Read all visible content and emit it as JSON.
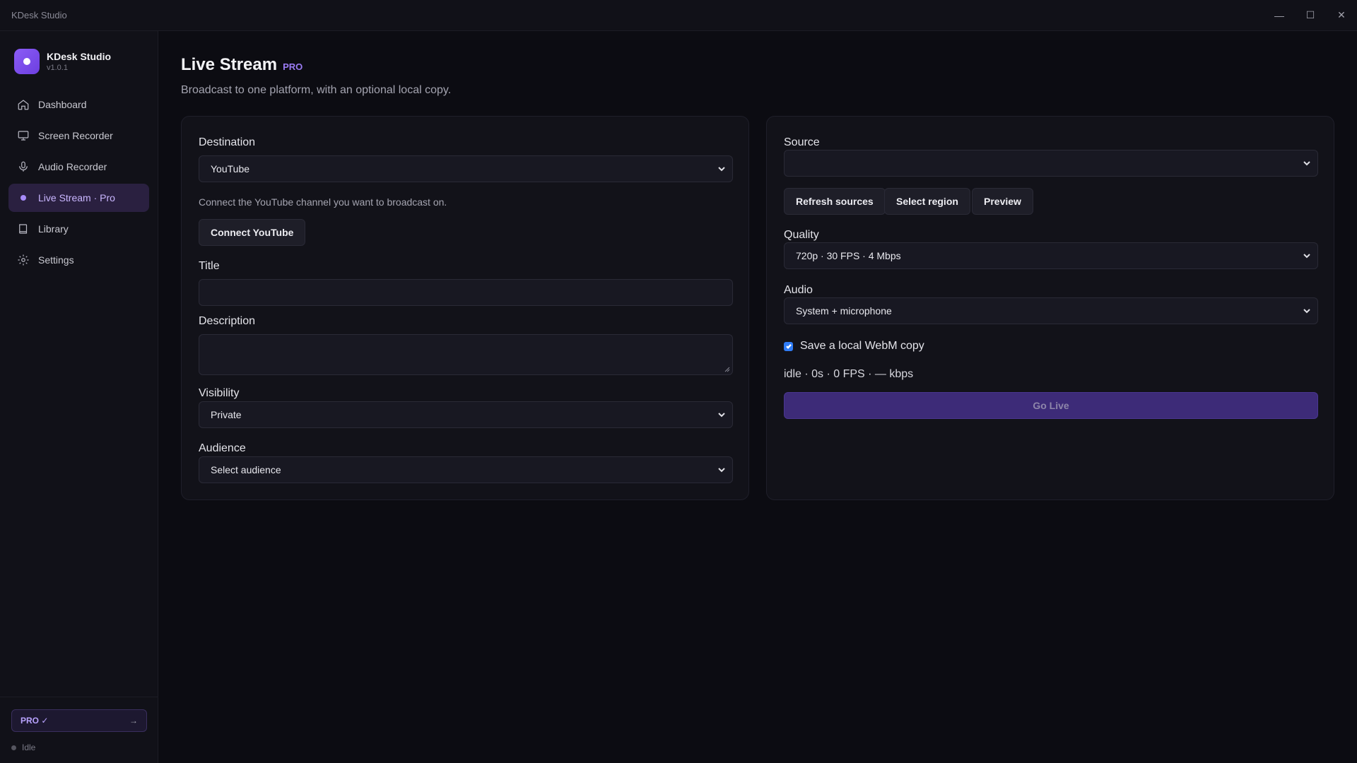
{
  "window": {
    "title": "KDesk Studio",
    "controls": {
      "minimize": "—",
      "maximize": "☐",
      "close": "✕"
    }
  },
  "brand": {
    "name": "KDesk Studio",
    "version": "v1.0.1"
  },
  "sidebar": {
    "items": [
      {
        "label": "Dashboard",
        "icon": "home-icon",
        "active": false
      },
      {
        "label": "Screen Recorder",
        "icon": "monitor-icon",
        "active": false
      },
      {
        "label": "Audio Recorder",
        "icon": "microphone-icon",
        "active": false
      },
      {
        "label": "Live Stream · Pro",
        "icon": "live-dot-icon",
        "active": true
      },
      {
        "label": "Library",
        "icon": "book-icon",
        "active": false
      },
      {
        "label": "Settings",
        "icon": "gear-icon",
        "active": false
      }
    ],
    "pro_badge": "PRO ✓",
    "pro_arrow": "→",
    "status": "Idle"
  },
  "page": {
    "title": "Live Stream",
    "pro_tag": "PRO",
    "subtitle": "Broadcast to one platform, with an optional local copy."
  },
  "left_card": {
    "destination_label": "Destination",
    "destination_value": "YouTube",
    "connect_helper": "Connect the YouTube channel you want to broadcast on.",
    "connect_button": "Connect YouTube",
    "title_label": "Title",
    "title_value": "",
    "description_label": "Description",
    "description_value": "",
    "visibility_label": "Visibility",
    "visibility_value": "Private",
    "audience_label": "Audience",
    "audience_value": "Select audience"
  },
  "right_card": {
    "source_label": "Source",
    "source_value": "",
    "refresh_button": "Refresh sources",
    "region_button": "Select region",
    "preview_button": "Preview",
    "quality_label": "Quality",
    "quality_value": "720p · 30 FPS · 4 Mbps",
    "audio_label": "Audio",
    "audio_value": "System + microphone",
    "save_local_label": "Save a local WebM copy",
    "save_local_checked": true,
    "stats": "idle · 0s · 0 FPS · — kbps",
    "go_live_button": "Go Live"
  },
  "colors": {
    "accent": "#8b5cf6",
    "active_nav_bg": "#2a2040",
    "go_live_bg": "#3d2b78",
    "checkbox": "#2f7cf6"
  }
}
